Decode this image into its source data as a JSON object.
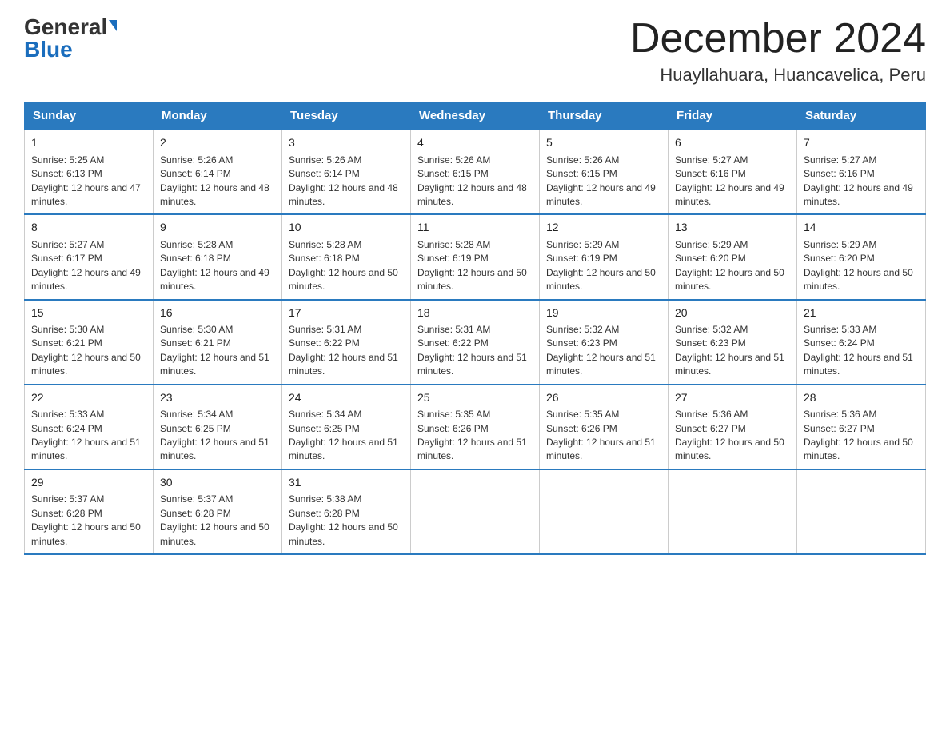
{
  "header": {
    "logo_general": "General",
    "logo_blue": "Blue",
    "month_title": "December 2024",
    "location": "Huayllahuara, Huancavelica, Peru"
  },
  "days_of_week": [
    "Sunday",
    "Monday",
    "Tuesday",
    "Wednesday",
    "Thursday",
    "Friday",
    "Saturday"
  ],
  "weeks": [
    [
      {
        "day": "1",
        "sunrise": "5:25 AM",
        "sunset": "6:13 PM",
        "daylight": "12 hours and 47 minutes."
      },
      {
        "day": "2",
        "sunrise": "5:26 AM",
        "sunset": "6:14 PM",
        "daylight": "12 hours and 48 minutes."
      },
      {
        "day": "3",
        "sunrise": "5:26 AM",
        "sunset": "6:14 PM",
        "daylight": "12 hours and 48 minutes."
      },
      {
        "day": "4",
        "sunrise": "5:26 AM",
        "sunset": "6:15 PM",
        "daylight": "12 hours and 48 minutes."
      },
      {
        "day": "5",
        "sunrise": "5:26 AM",
        "sunset": "6:15 PM",
        "daylight": "12 hours and 49 minutes."
      },
      {
        "day": "6",
        "sunrise": "5:27 AM",
        "sunset": "6:16 PM",
        "daylight": "12 hours and 49 minutes."
      },
      {
        "day": "7",
        "sunrise": "5:27 AM",
        "sunset": "6:16 PM",
        "daylight": "12 hours and 49 minutes."
      }
    ],
    [
      {
        "day": "8",
        "sunrise": "5:27 AM",
        "sunset": "6:17 PM",
        "daylight": "12 hours and 49 minutes."
      },
      {
        "day": "9",
        "sunrise": "5:28 AM",
        "sunset": "6:18 PM",
        "daylight": "12 hours and 49 minutes."
      },
      {
        "day": "10",
        "sunrise": "5:28 AM",
        "sunset": "6:18 PM",
        "daylight": "12 hours and 50 minutes."
      },
      {
        "day": "11",
        "sunrise": "5:28 AM",
        "sunset": "6:19 PM",
        "daylight": "12 hours and 50 minutes."
      },
      {
        "day": "12",
        "sunrise": "5:29 AM",
        "sunset": "6:19 PM",
        "daylight": "12 hours and 50 minutes."
      },
      {
        "day": "13",
        "sunrise": "5:29 AM",
        "sunset": "6:20 PM",
        "daylight": "12 hours and 50 minutes."
      },
      {
        "day": "14",
        "sunrise": "5:29 AM",
        "sunset": "6:20 PM",
        "daylight": "12 hours and 50 minutes."
      }
    ],
    [
      {
        "day": "15",
        "sunrise": "5:30 AM",
        "sunset": "6:21 PM",
        "daylight": "12 hours and 50 minutes."
      },
      {
        "day": "16",
        "sunrise": "5:30 AM",
        "sunset": "6:21 PM",
        "daylight": "12 hours and 51 minutes."
      },
      {
        "day": "17",
        "sunrise": "5:31 AM",
        "sunset": "6:22 PM",
        "daylight": "12 hours and 51 minutes."
      },
      {
        "day": "18",
        "sunrise": "5:31 AM",
        "sunset": "6:22 PM",
        "daylight": "12 hours and 51 minutes."
      },
      {
        "day": "19",
        "sunrise": "5:32 AM",
        "sunset": "6:23 PM",
        "daylight": "12 hours and 51 minutes."
      },
      {
        "day": "20",
        "sunrise": "5:32 AM",
        "sunset": "6:23 PM",
        "daylight": "12 hours and 51 minutes."
      },
      {
        "day": "21",
        "sunrise": "5:33 AM",
        "sunset": "6:24 PM",
        "daylight": "12 hours and 51 minutes."
      }
    ],
    [
      {
        "day": "22",
        "sunrise": "5:33 AM",
        "sunset": "6:24 PM",
        "daylight": "12 hours and 51 minutes."
      },
      {
        "day": "23",
        "sunrise": "5:34 AM",
        "sunset": "6:25 PM",
        "daylight": "12 hours and 51 minutes."
      },
      {
        "day": "24",
        "sunrise": "5:34 AM",
        "sunset": "6:25 PM",
        "daylight": "12 hours and 51 minutes."
      },
      {
        "day": "25",
        "sunrise": "5:35 AM",
        "sunset": "6:26 PM",
        "daylight": "12 hours and 51 minutes."
      },
      {
        "day": "26",
        "sunrise": "5:35 AM",
        "sunset": "6:26 PM",
        "daylight": "12 hours and 51 minutes."
      },
      {
        "day": "27",
        "sunrise": "5:36 AM",
        "sunset": "6:27 PM",
        "daylight": "12 hours and 50 minutes."
      },
      {
        "day": "28",
        "sunrise": "5:36 AM",
        "sunset": "6:27 PM",
        "daylight": "12 hours and 50 minutes."
      }
    ],
    [
      {
        "day": "29",
        "sunrise": "5:37 AM",
        "sunset": "6:28 PM",
        "daylight": "12 hours and 50 minutes."
      },
      {
        "day": "30",
        "sunrise": "5:37 AM",
        "sunset": "6:28 PM",
        "daylight": "12 hours and 50 minutes."
      },
      {
        "day": "31",
        "sunrise": "5:38 AM",
        "sunset": "6:28 PM",
        "daylight": "12 hours and 50 minutes."
      },
      null,
      null,
      null,
      null
    ]
  ]
}
